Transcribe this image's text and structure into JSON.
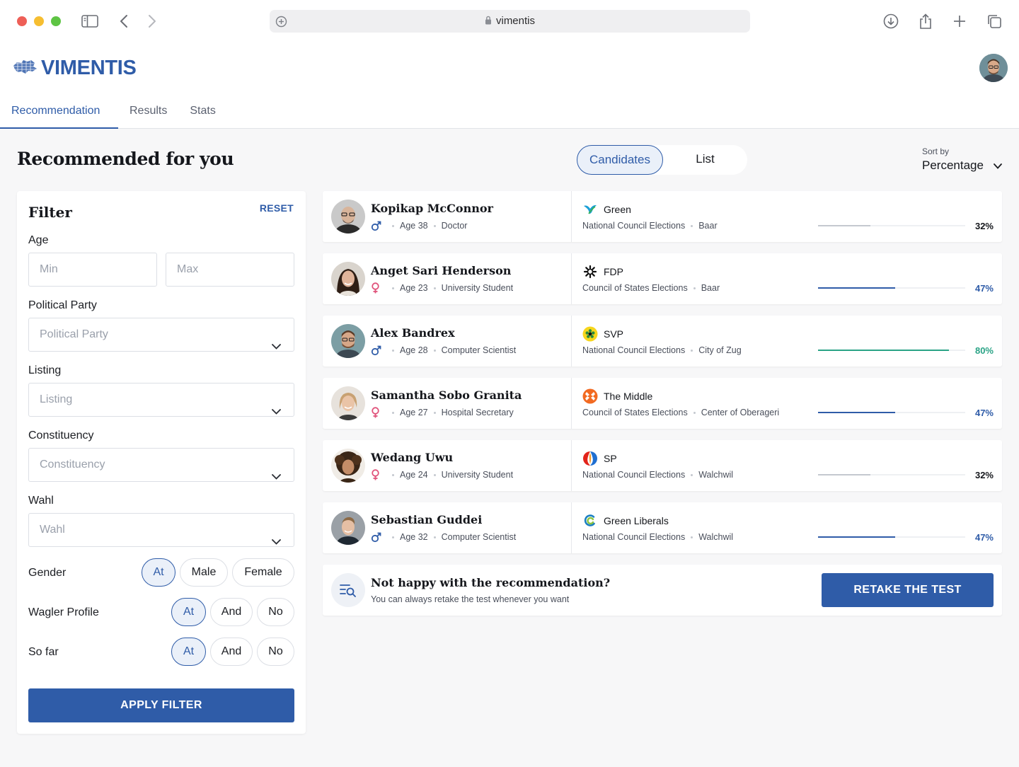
{
  "browser": {
    "url": "vimentis",
    "icons": [
      "sidebar-icon",
      "back-icon",
      "forward-icon",
      "add-tab-icon",
      "lock-icon",
      "download-icon",
      "share-icon",
      "new-tab-icon",
      "tabs-overview-icon"
    ]
  },
  "header": {
    "logo_text": "VIMENTIS",
    "tabs": [
      {
        "label": "Recommendation",
        "active": true
      },
      {
        "label": "Results",
        "active": false
      },
      {
        "label": "Stats",
        "active": false
      }
    ]
  },
  "page": {
    "title": "Recommended for you",
    "view_toggle": {
      "candidates": "Candidates",
      "list": "List",
      "active": "Candidates"
    },
    "sort": {
      "label": "Sort by",
      "value": "Percentage"
    }
  },
  "filter": {
    "title": "Filter",
    "reset": "RESET",
    "age": {
      "label": "Age",
      "min_placeholder": "Min",
      "max_placeholder": "Max"
    },
    "party": {
      "label": "Political Party",
      "placeholder": "Political Party"
    },
    "listing": {
      "label": "Listing",
      "placeholder": "Listing"
    },
    "constituency": {
      "label": "Constituency",
      "placeholder": "Constituency"
    },
    "wahl": {
      "label": "Wahl",
      "placeholder": "Wahl"
    },
    "gender": {
      "label": "Gender",
      "options": [
        "At",
        "Male",
        "Female"
      ],
      "selected": "At"
    },
    "wagler_profile": {
      "label": "Wagler Profile",
      "options": [
        "At",
        "And",
        "No"
      ],
      "selected": "At"
    },
    "so_far": {
      "label": "So far",
      "options": [
        "At",
        "And",
        "No"
      ],
      "selected": "At"
    },
    "apply": "APPLY FILTER"
  },
  "candidates": [
    {
      "name": "Kopikap McConnor",
      "gender": "male",
      "age": "Age 38",
      "occupation": "Doctor",
      "party": "Green",
      "party_icon": "green-party-icon",
      "election": "National Council Elections",
      "location": "Baar",
      "percent_label": "32%",
      "percent": 32,
      "color": "#c4c8cf",
      "text_color": "#15171c"
    },
    {
      "name": "Anget Sari Henderson",
      "gender": "female",
      "age": "Age 23",
      "occupation": "University Student",
      "party": "FDP",
      "party_icon": "fdp-icon",
      "election": "Council of States Elections",
      "location": "Baar",
      "percent_label": "47%",
      "percent": 47,
      "color": "#2f5ca8",
      "text_color": "#2f5ca8"
    },
    {
      "name": "Alex Bandrex",
      "gender": "male",
      "age": "Age 28",
      "occupation": "Computer Scientist",
      "party": "SVP",
      "party_icon": "svp-icon",
      "election": "National Council Elections",
      "location": "City of Zug",
      "percent_label": "80%",
      "percent": 80,
      "color": "#2aa386",
      "text_color": "#2aa386"
    },
    {
      "name": "Samantha Sobo Granita",
      "gender": "female",
      "age": "Age 27",
      "occupation": "Hospital Secretary",
      "party": "The Middle",
      "party_icon": "the-middle-icon",
      "election": "Council of States Elections",
      "location": "Center of Oberageri",
      "percent_label": "47%",
      "percent": 47,
      "color": "#2f5ca8",
      "text_color": "#2f5ca8"
    },
    {
      "name": "Wedang Uwu",
      "gender": "female",
      "age": "Age 24",
      "occupation": "University Student",
      "party": "SP",
      "party_icon": "sp-icon",
      "election": "National Council Elections",
      "location": "Walchwil",
      "percent_label": "32%",
      "percent": 32,
      "color": "#c4c8cf",
      "text_color": "#15171c"
    },
    {
      "name": "Sebastian Guddei",
      "gender": "male",
      "age": "Age 32",
      "occupation": "Computer Scientist",
      "party": "Green Liberals",
      "party_icon": "green-liberals-icon",
      "election": "National Council Elections",
      "location": "Walchwil",
      "percent_label": "47%",
      "percent": 47,
      "color": "#2f5ca8",
      "text_color": "#2f5ca8"
    }
  ],
  "cta": {
    "question": "Not happy with the recommendation?",
    "subtext": "You can always retake the test whenever you want",
    "button": "RETAKE THE TEST"
  },
  "colors": {
    "brand": "#2f5ca8",
    "match_high": "#2aa386",
    "match_low": "#c4c8cf"
  }
}
